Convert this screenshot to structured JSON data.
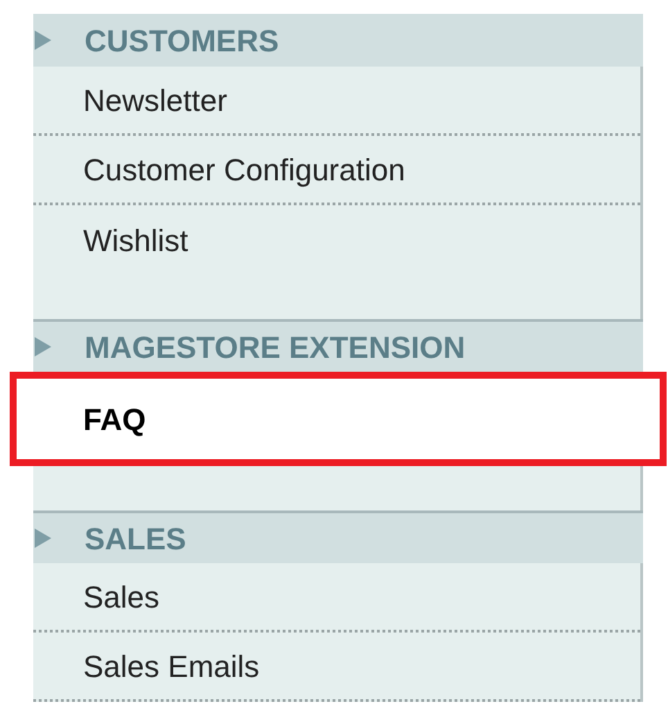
{
  "sections": [
    {
      "title": "CUSTOMERS",
      "bottom_spacer": true,
      "items": [
        {
          "label": "Newsletter",
          "selected": false
        },
        {
          "label": "Customer Configuration",
          "selected": false
        },
        {
          "label": "Wishlist",
          "selected": false
        }
      ]
    },
    {
      "title": "MAGESTORE EXTENSION",
      "bottom_spacer": true,
      "items": [
        {
          "label": "FAQ",
          "selected": true
        }
      ]
    },
    {
      "title": "SALES",
      "bottom_spacer": false,
      "items": [
        {
          "label": "Sales",
          "selected": false
        },
        {
          "label": "Sales Emails",
          "selected": false
        }
      ]
    }
  ]
}
